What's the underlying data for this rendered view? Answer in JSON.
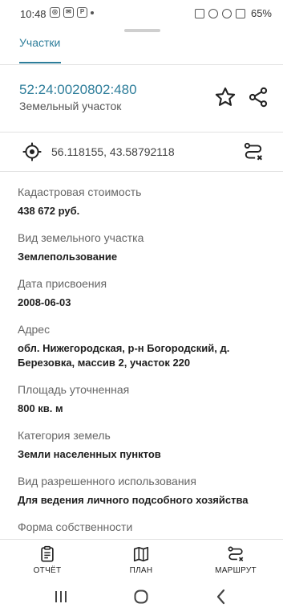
{
  "status_bar": {
    "time": "10:48",
    "battery": "65%"
  },
  "tabs": [
    {
      "label": "Участки"
    }
  ],
  "parcel": {
    "cadastral_number": "52:24:0020802:480",
    "type": "Земельный участок"
  },
  "coordinates": "56.118155, 43.58792118",
  "fields": [
    {
      "label": "Кадастровая стоимость",
      "value": "438 672 руб."
    },
    {
      "label": "Вид земельного участка",
      "value": "Землепользование"
    },
    {
      "label": "Дата присвоения",
      "value": "2008-06-03"
    },
    {
      "label": "Адрес",
      "value": "обл. Нижегородская, р-н Богородский, д. Березовка, массив 2, участок 220"
    },
    {
      "label": "Площадь уточненная",
      "value": "800 кв. м"
    },
    {
      "label": "Категория земель",
      "value": "Земли населенных пунктов"
    },
    {
      "label": "Вид разрешенного использования",
      "value": "Для ведения личного подсобного хозяйства"
    },
    {
      "label": "Форма собственности",
      "value": ""
    }
  ],
  "bottom_nav": [
    {
      "label": "ОТЧЁТ",
      "icon": "report-icon"
    },
    {
      "label": "ПЛАН",
      "icon": "map-plan-icon"
    },
    {
      "label": "МАРШРУТ",
      "icon": "route-icon"
    }
  ],
  "colors": {
    "accent": "#2d7d9a",
    "text": "#1e1e1e",
    "label": "#666666"
  }
}
